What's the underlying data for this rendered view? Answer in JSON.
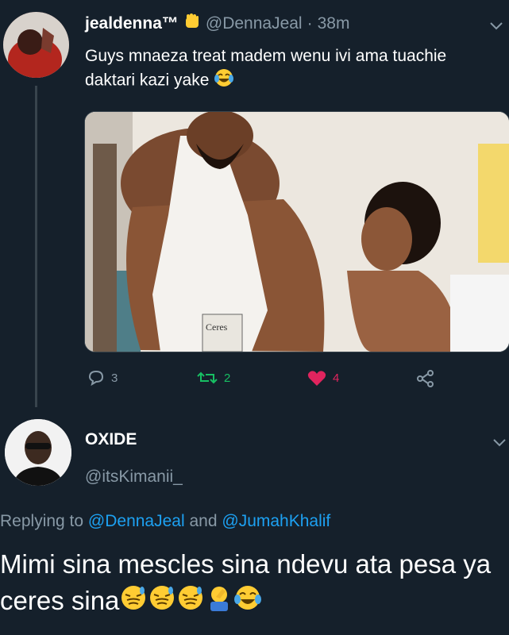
{
  "tweet": {
    "display_name": "jealdenna™",
    "badge_icon": "raised-fist-emoji",
    "handle": "@DennaJeal",
    "separator": "·",
    "time": "38m",
    "text": "Guys mnaeza treat madem wenu ivi ama tuachie daktari kazi yake",
    "text_emoji": "tears-of-joy-emoji",
    "actions": {
      "reply_count": "3",
      "retweet_count": "2",
      "like_count": "4"
    },
    "media_box_label": "Ceres",
    "colors": {
      "retweet": "#17bf63",
      "like": "#e0245e",
      "muted": "#8899a6"
    }
  },
  "reply": {
    "display_name": "OXIDE",
    "handle": "@itsKimanii_",
    "replying_prefix": "Replying to",
    "mention1": "@DennaJeal",
    "and_word": "and",
    "mention2": "@JumahKhalif",
    "text": "Mimi sina mescles sina ndevu ata pesa ya ceres sina",
    "emojis": [
      "sad-but-relieved-emoji",
      "sad-but-relieved-emoji",
      "sad-but-relieved-emoji",
      "facepalm-emoji",
      "tears-of-joy-emoji"
    ]
  }
}
